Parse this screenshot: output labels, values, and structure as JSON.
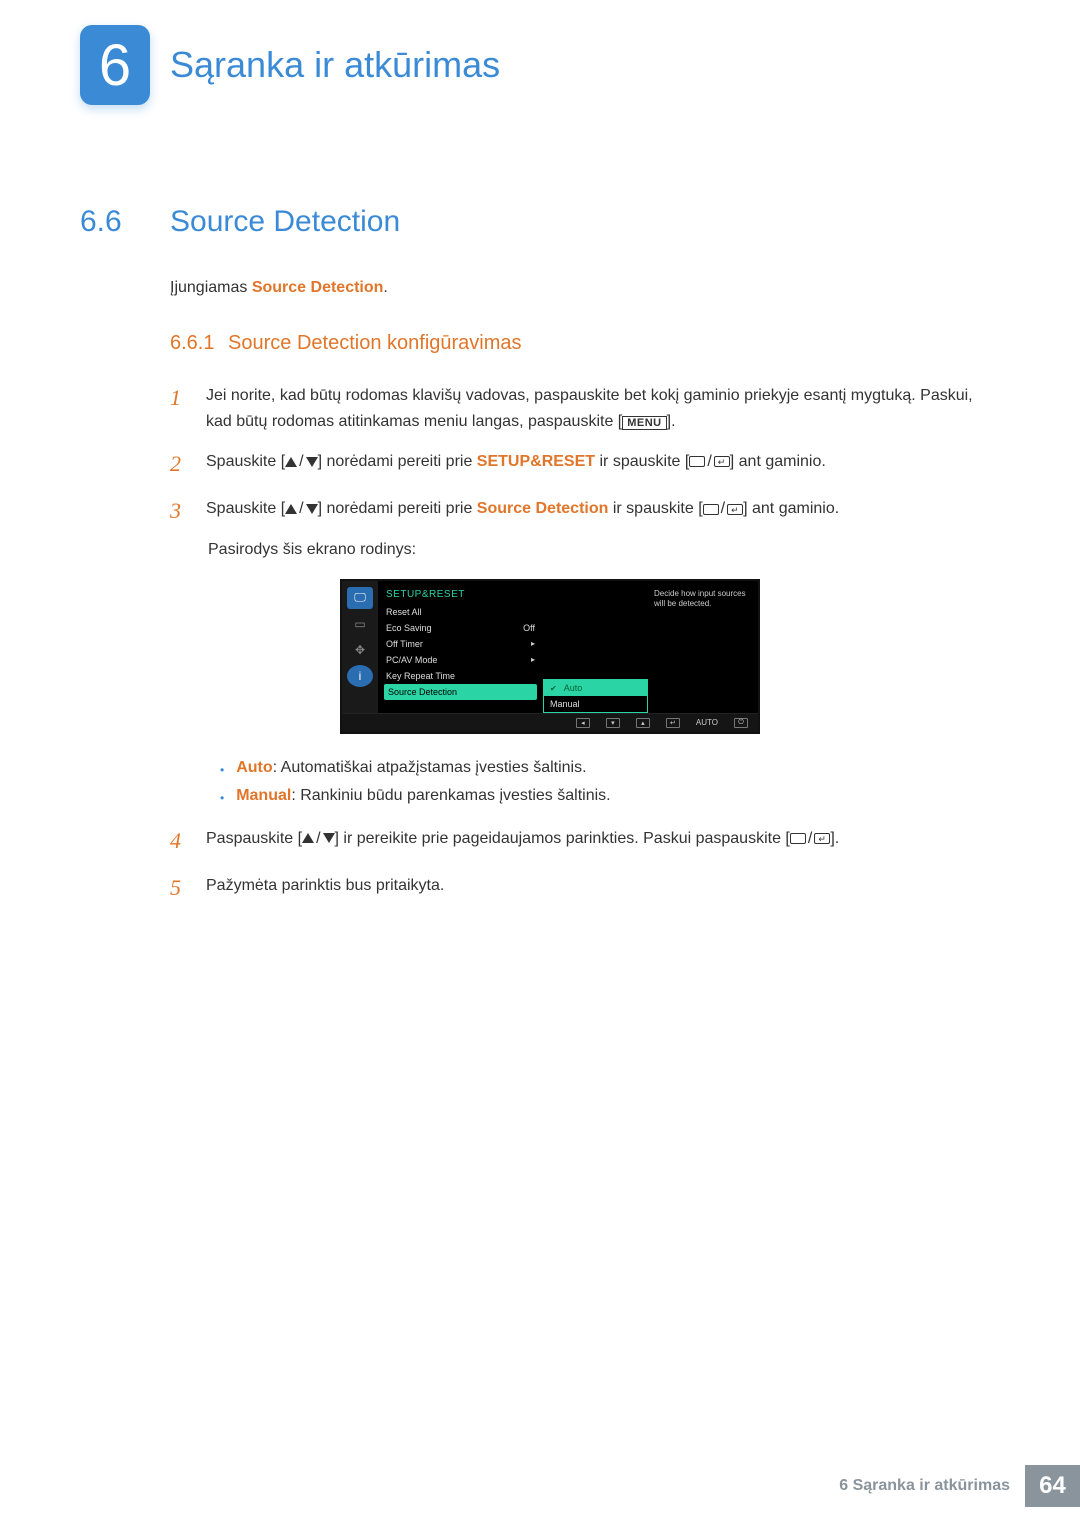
{
  "chapter": {
    "number": "6",
    "title": "Sąranka ir atkūrimas"
  },
  "section": {
    "number": "6.6",
    "title": "Source Detection"
  },
  "intro": {
    "prefix": "Įjungiamas ",
    "bold": "Source Detection",
    "suffix": "."
  },
  "subsection": {
    "number": "6.6.1",
    "title": "Source Detection konfigūravimas"
  },
  "steps": {
    "s1": {
      "num": "1",
      "line1": "Jei norite, kad būtų rodomas klavišų vadovas, paspauskite bet kokį gaminio priekyje esantį mygtuką.",
      "line2a": "Paskui, kad būtų rodomas atitinkamas meniu langas, paspauskite [",
      "menu": "MENU",
      "line2b": "]."
    },
    "s2": {
      "num": "2",
      "a": "Spauskite [",
      "b": "] norėdami pereiti prie ",
      "bold": "SETUP&RESET",
      "c": " ir spauskite [",
      "d": "] ant gaminio."
    },
    "s3": {
      "num": "3",
      "a": "Spauskite [",
      "b": "] norėdami pereiti prie ",
      "bold": "Source Detection",
      "c": " ir spauskite [",
      "d": "] ant gaminio."
    },
    "post3": "Pasirodys šis ekrano rodinys:",
    "s4": {
      "num": "4",
      "a": "Paspauskite [",
      "b": "] ir pereikite prie pageidaujamos parinkties. Paskui paspauskite [",
      "c": "]."
    },
    "s5": {
      "num": "5",
      "text": "Pažymėta parinktis bus pritaikyta."
    }
  },
  "osd": {
    "title": "SETUP&RESET",
    "rows": {
      "reset": "Reset All",
      "eco": "Eco Saving",
      "eco_val": "Off",
      "timer": "Off Timer",
      "pcav": "PC/AV Mode",
      "keyrep": "Key Repeat Time",
      "srcdet": "Source Detection"
    },
    "opts": {
      "auto": "Auto",
      "manual": "Manual"
    },
    "help": "Decide how input sources will be detected.",
    "footer_auto": "AUTO"
  },
  "bullets": {
    "auto_label": "Auto",
    "auto_text": ": Automatiškai atpažįstamas įvesties šaltinis.",
    "manual_label": "Manual",
    "manual_text": ": Rankiniu būdu parenkamas įvesties šaltinis."
  },
  "footer": {
    "text": "6 Sąranka ir atkūrimas",
    "page": "64"
  }
}
